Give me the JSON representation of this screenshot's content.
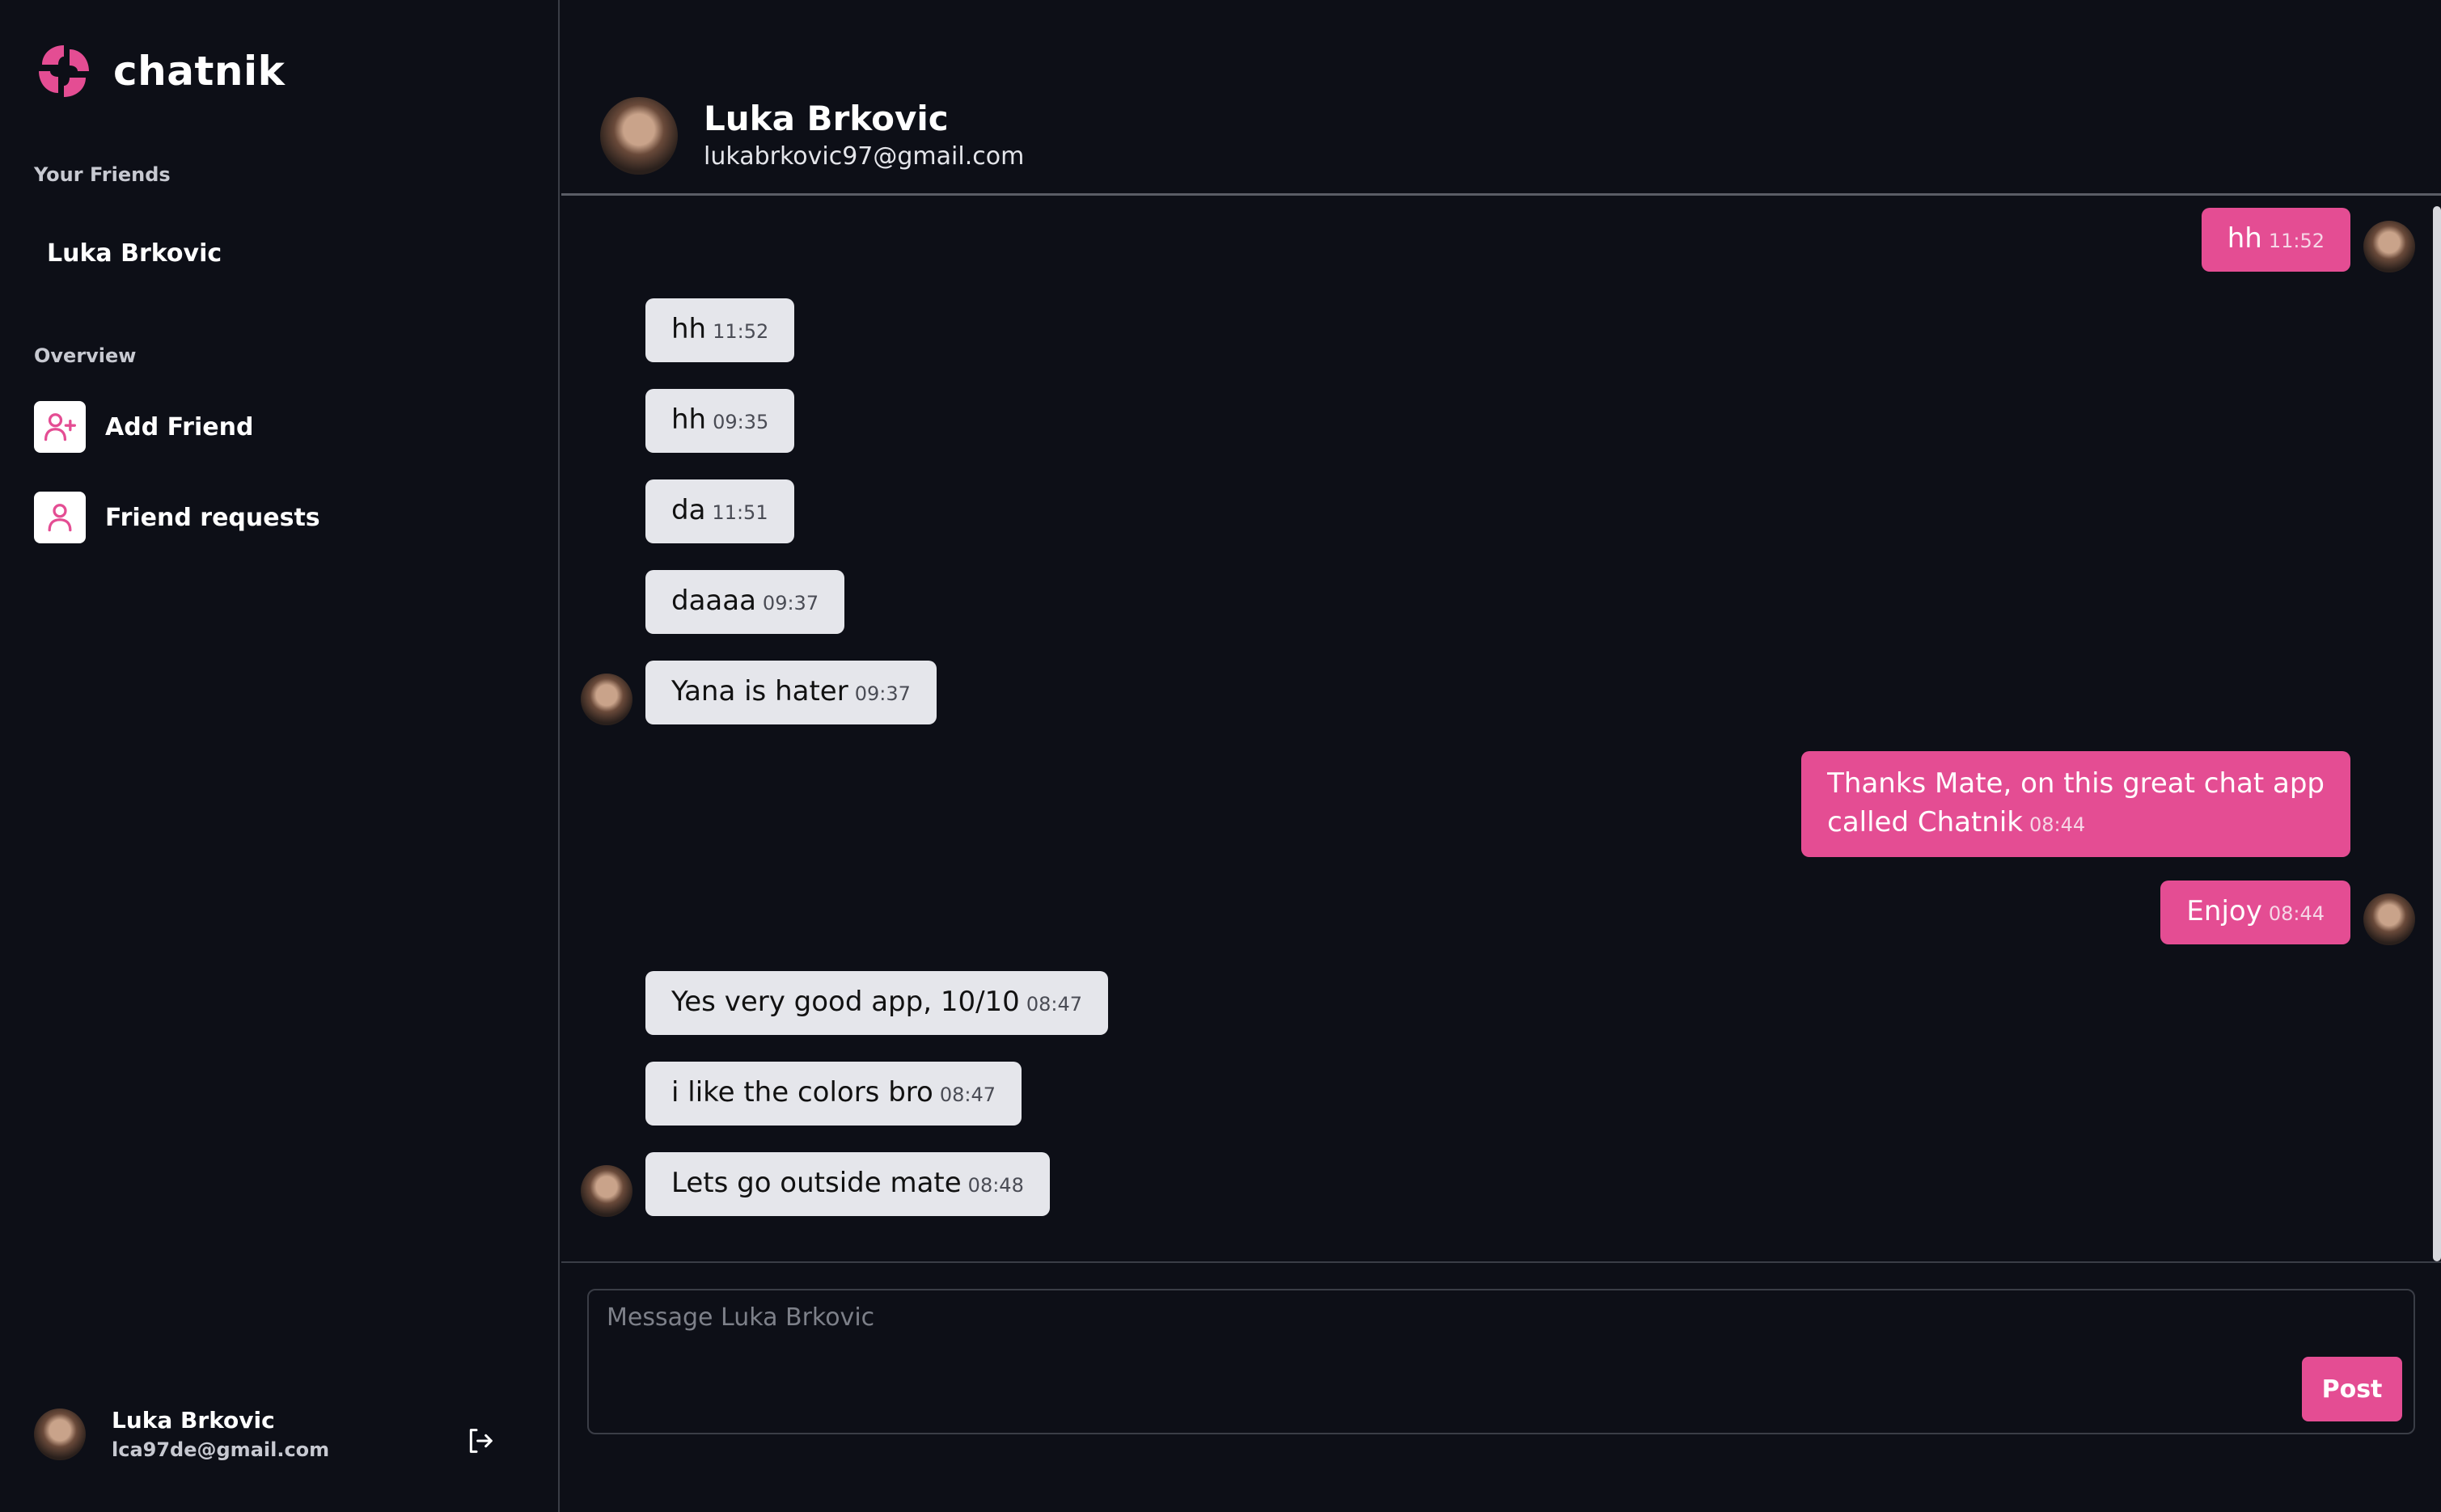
{
  "brand": {
    "name": "chatnik",
    "logo_icon": "chatnik-logo-icon",
    "accent_color": "#e44d93"
  },
  "sidebar": {
    "friends_label": "Your Friends",
    "friends": [
      {
        "name": "Luka Brkovic"
      }
    ],
    "overview_label": "Overview",
    "overview_items": [
      {
        "label": "Add Friend",
        "icon": "add-user-icon"
      },
      {
        "label": "Friend requests",
        "icon": "user-icon"
      }
    ],
    "current_user": {
      "name": "Luka Brkovic",
      "email": "lca97de@gmail.com"
    },
    "logout_icon": "logout-icon"
  },
  "chat": {
    "partner_name": "Luka Brkovic",
    "partner_email": "lukabrkovic97@gmail.com",
    "messages": [
      {
        "text": "hh",
        "time": "11:52",
        "from": "me"
      },
      {
        "text": "hh",
        "time": "11:52",
        "from": "them"
      },
      {
        "text": "hh",
        "time": "09:35",
        "from": "them"
      },
      {
        "text": "da",
        "time": "11:51",
        "from": "them"
      },
      {
        "text": "daaaa",
        "time": "09:37",
        "from": "them"
      },
      {
        "text": "Yana is hater",
        "time": "09:37",
        "from": "them"
      },
      {
        "text": "Thanks Mate, on this great chat app",
        "text2": "called Chatnik",
        "time": "08:44",
        "from": "me"
      },
      {
        "text": "Enjoy",
        "time": "08:44",
        "from": "me"
      },
      {
        "text": "Yes very good app, 10/10",
        "time": "08:47",
        "from": "them"
      },
      {
        "text": "i like the colors bro",
        "time": "08:47",
        "from": "them"
      },
      {
        "text": "Lets go outside mate",
        "time": "08:48",
        "from": "them"
      }
    ]
  },
  "composer": {
    "placeholder": "Message Luka Brkovic",
    "post_label": "Post"
  }
}
